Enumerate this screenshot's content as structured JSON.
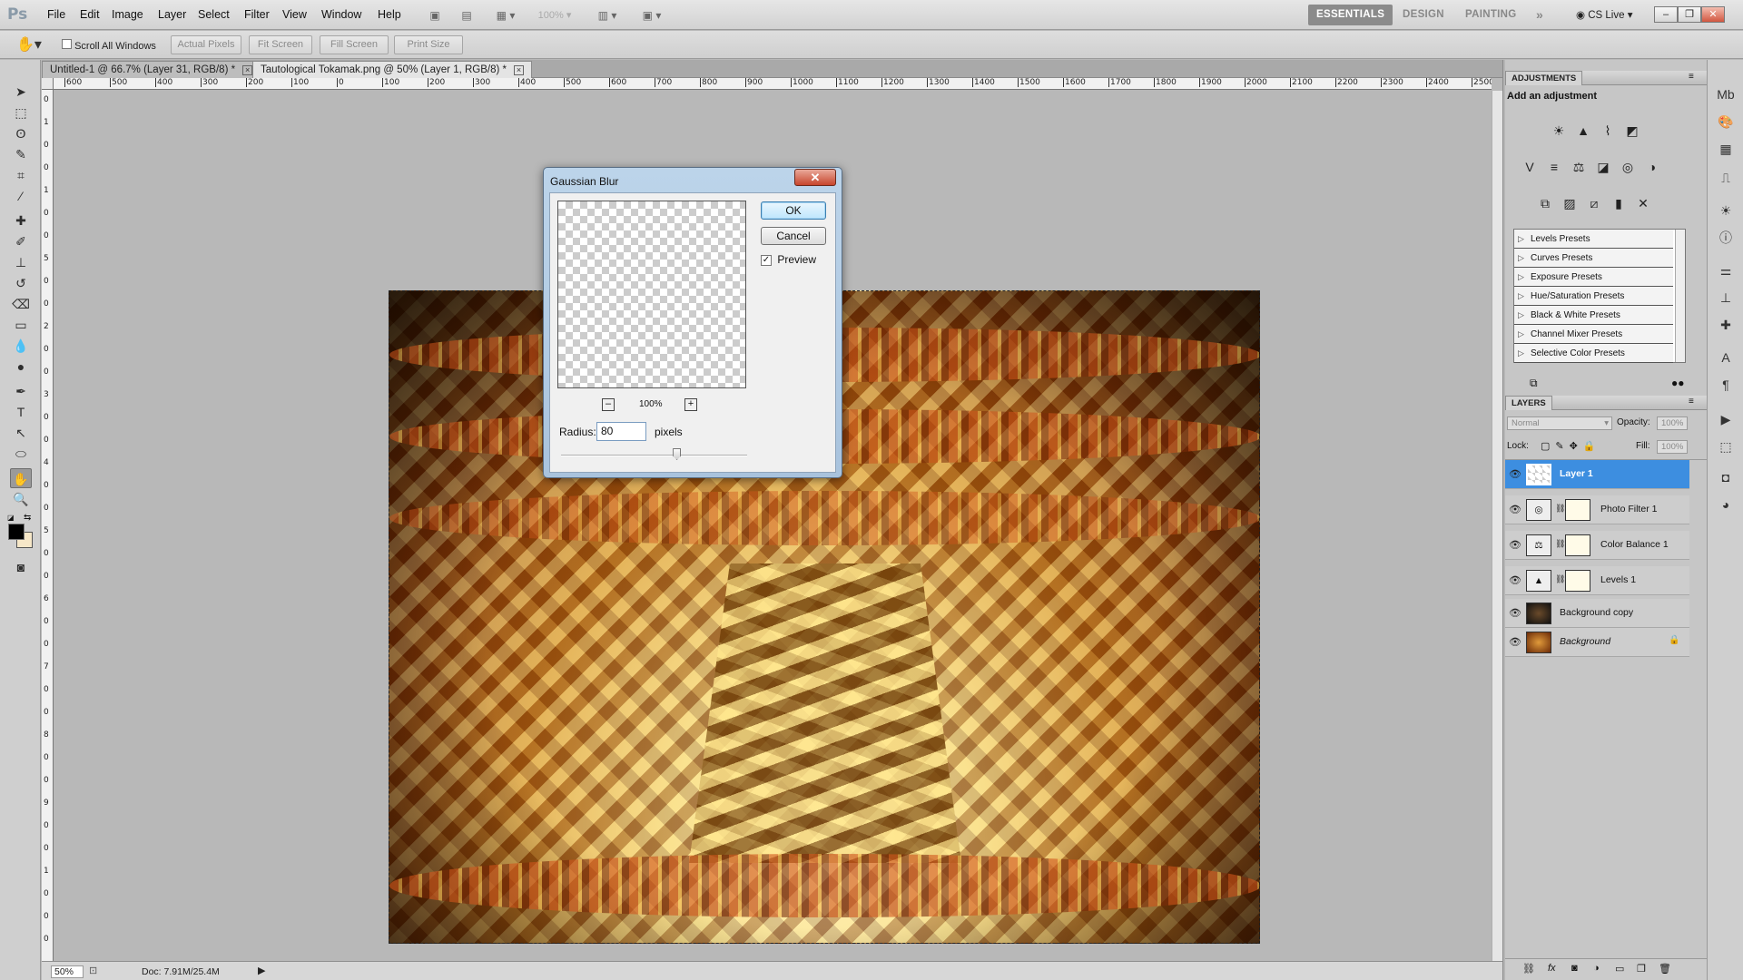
{
  "app": {
    "logo": "Ps"
  },
  "menu": [
    "File",
    "Edit",
    "Image",
    "Layer",
    "Select",
    "Filter",
    "View",
    "Window",
    "Help"
  ],
  "menubar_extra": {
    "zoom": "100%"
  },
  "workspaces": [
    "ESSENTIALS",
    "DESIGN",
    "PAINTING"
  ],
  "workspace_more": "»",
  "cs_live": "CS Live",
  "window_controls": {
    "minimize": "–",
    "restore": "❐",
    "close": "✕"
  },
  "options": {
    "scroll_all_windows": "Scroll All Windows",
    "buttons": [
      "Actual Pixels",
      "Fit Screen",
      "Fill Screen",
      "Print Size"
    ]
  },
  "tabs": [
    {
      "label": "Untitled-1 @ 66.7% (Layer 31, RGB/8) *",
      "close": "×"
    },
    {
      "label": "Tautological Tokamak.png @ 50% (Layer 1, RGB/8) *",
      "close": "×"
    }
  ],
  "ruler_h": [
    "600",
    "500",
    "400",
    "300",
    "200",
    "100",
    "0",
    "100",
    "200",
    "300",
    "400",
    "500",
    "600",
    "700",
    "800",
    "900",
    "1000",
    "1100",
    "1200",
    "1300",
    "1400",
    "1500",
    "1600",
    "1700",
    "1800",
    "1900",
    "2000",
    "2100",
    "2200",
    "2300",
    "2400",
    "2500"
  ],
  "ruler_v": [
    "0",
    "1",
    "0",
    "0",
    "1",
    "0",
    "0",
    "5",
    "0",
    "0",
    "2",
    "0",
    "0",
    "3",
    "0",
    "0",
    "4",
    "0",
    "0",
    "5",
    "0",
    "0",
    "6",
    "0",
    "0",
    "7",
    "0",
    "0",
    "8",
    "0",
    "0",
    "9",
    "0",
    "0",
    "1",
    "0",
    "0",
    "0"
  ],
  "status": {
    "zoom": "50%",
    "doc": "Doc: 7.91M/25.4M"
  },
  "dialog": {
    "title": "Gaussian Blur",
    "close": "✕",
    "ok": "OK",
    "cancel": "Cancel",
    "preview_label": "Preview",
    "preview_checked": true,
    "zoom_minus": "–",
    "zoom_level": "100%",
    "zoom_plus": "+",
    "radius_label": "Radius:",
    "radius_value": "80",
    "radius_unit": "pixels",
    "radius_slider_fraction": 0.62
  },
  "adjustments": {
    "tab": "ADJUSTMENTS",
    "heading": "Add an adjustment",
    "presets": [
      "Levels Presets",
      "Curves Presets",
      "Exposure Presets",
      "Hue/Saturation Presets",
      "Black & White Presets",
      "Channel Mixer Presets",
      "Selective Color Presets"
    ]
  },
  "layers": {
    "tab": "LAYERS",
    "blend_mode": "Normal",
    "opacity_label": "Opacity:",
    "opacity": "100%",
    "lock_label": "Lock:",
    "fill_label": "Fill:",
    "fill": "100%",
    "items": [
      {
        "name": "Layer 1",
        "selected": true
      },
      {
        "name": "Photo Filter 1",
        "selected": false
      },
      {
        "name": "Color Balance 1",
        "selected": false
      },
      {
        "name": "Levels 1",
        "selected": false
      },
      {
        "name": "Background copy",
        "selected": false
      },
      {
        "name": "Background",
        "selected": false
      }
    ]
  },
  "colors": {
    "selection": "#3d8ee0",
    "dialog_frame": "#a9c3dd",
    "close_red": "#c7452c"
  }
}
